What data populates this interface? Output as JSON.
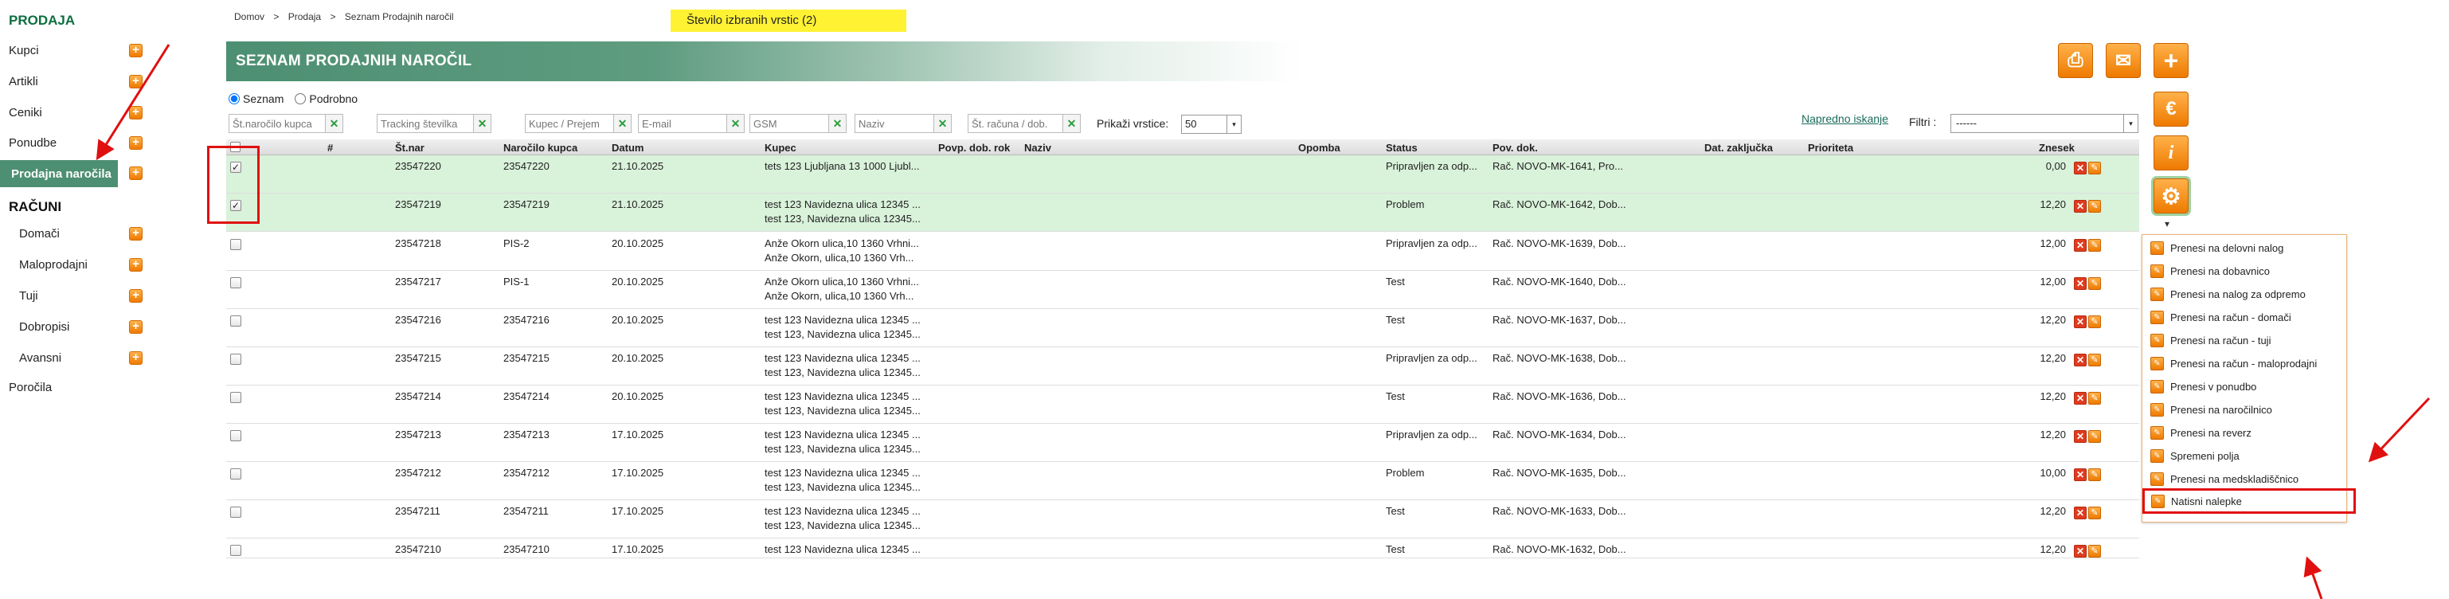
{
  "sidebar": {
    "prodaja_title": "PRODAJA",
    "prodaja_items": [
      {
        "label": "Kupci"
      },
      {
        "label": "Artikli"
      },
      {
        "label": "Ceniki"
      },
      {
        "label": "Ponudbe"
      },
      {
        "label": "Prodajna naročila"
      }
    ],
    "racuni_title": "RAČUNI",
    "racuni_items": [
      {
        "label": "Domači"
      },
      {
        "label": "Maloprodajni"
      },
      {
        "label": "Tuji"
      },
      {
        "label": "Dobropisi"
      },
      {
        "label": "Avansni"
      }
    ],
    "porocila": "Poročila",
    "plus_glyph": "+"
  },
  "breadcrumb": [
    "Domov",
    ">",
    "Prodaja",
    ">",
    "Seznam Prodajnih naročil"
  ],
  "selected_info": "Število izbranih vrstic (2)",
  "header": {
    "title": "SEZNAM PRODAJNIH NAROČIL"
  },
  "view_mode": {
    "seznam": "Seznam",
    "podrobno": "Podrobno"
  },
  "filters": {
    "placeholders": [
      "Št.naročilo kupca",
      "Tracking številka",
      "Kupec / Prejem",
      "E-mail",
      "GSM",
      "Naziv",
      "Št. računa / dob."
    ],
    "clear_glyph": "✕",
    "rows_label": "Prikaži vrstice:",
    "rows_value": "50",
    "advanced": "Napredno iskanje",
    "filter_label": "Filtri :",
    "filter_value": "------"
  },
  "table": {
    "headers": [
      "#",
      "Št.nar",
      "Naročilo kupca",
      "Datum",
      "Kupec",
      "Povp. dob. rok",
      "Naziv",
      "Opomba",
      "Status",
      "Pov. dok.",
      "Dat. zaključka",
      "Prioriteta",
      "Znesek"
    ],
    "rows": [
      {
        "stnar": "23547220",
        "narocilo": "23547220",
        "datum": "21.10.2025",
        "kupec1": "tets 123 Ljubljana 13 1000 Ljubl...",
        "kupec2": "",
        "status": "Pripravljen za odp...",
        "povdok": "Rač. NOVO-MK-1641, Pro...",
        "znesek": "0,00",
        "checked": "✓"
      },
      {
        "stnar": "23547219",
        "narocilo": "23547219",
        "datum": "21.10.2025",
        "kupec1": "test 123 Navidezna ulica 12345 ...",
        "kupec2": "test 123, Navidezna ulica 12345...",
        "status": "Problem",
        "povdok": "Rač. NOVO-MK-1642, Dob...",
        "znesek": "12,20",
        "checked": "✓"
      },
      {
        "stnar": "23547218",
        "narocilo": "PIS-2",
        "datum": "20.10.2025",
        "kupec1": "Anže Okorn ulica,10 1360 Vrhni...",
        "kupec2": "Anže Okorn, ulica,10 1360 Vrh...",
        "status": "Pripravljen za odp...",
        "povdok": "Rač. NOVO-MK-1639, Dob...",
        "znesek": "12,00",
        "checked": ""
      },
      {
        "stnar": "23547217",
        "narocilo": "PIS-1",
        "datum": "20.10.2025",
        "kupec1": "Anže Okorn ulica,10 1360 Vrhni...",
        "kupec2": "Anže Okorn, ulica,10 1360 Vrh...",
        "status": "Test",
        "povdok": "Rač. NOVO-MK-1640, Dob...",
        "znesek": "12,00",
        "checked": ""
      },
      {
        "stnar": "23547216",
        "narocilo": "23547216",
        "datum": "20.10.2025",
        "kupec1": "test 123 Navidezna ulica 12345 ...",
        "kupec2": "test 123, Navidezna ulica 12345...",
        "status": "Test",
        "povdok": "Rač. NOVO-MK-1637, Dob...",
        "znesek": "12,20",
        "checked": ""
      },
      {
        "stnar": "23547215",
        "narocilo": "23547215",
        "datum": "20.10.2025",
        "kupec1": "test 123 Navidezna ulica 12345 ...",
        "kupec2": "test 123, Navidezna ulica 12345...",
        "status": "Pripravljen za odp...",
        "povdok": "Rač. NOVO-MK-1638, Dob...",
        "znesek": "12,20",
        "checked": ""
      },
      {
        "stnar": "23547214",
        "narocilo": "23547214",
        "datum": "20.10.2025",
        "kupec1": "test 123 Navidezna ulica 12345 ...",
        "kupec2": "test 123, Navidezna ulica 12345...",
        "status": "Test",
        "povdok": "Rač. NOVO-MK-1636, Dob...",
        "znesek": "12,20",
        "checked": ""
      },
      {
        "stnar": "23547213",
        "narocilo": "23547213",
        "datum": "17.10.2025",
        "kupec1": "test 123 Navidezna ulica 12345 ...",
        "kupec2": "test 123, Navidezna ulica 12345...",
        "status": "Pripravljen za odp...",
        "povdok": "Rač. NOVO-MK-1634, Dob...",
        "znesek": "12,20",
        "checked": ""
      },
      {
        "stnar": "23547212",
        "narocilo": "23547212",
        "datum": "17.10.2025",
        "kupec1": "test 123 Navidezna ulica 12345 ...",
        "kupec2": "test 123, Navidezna ulica 12345...",
        "status": "Problem",
        "povdok": "Rač. NOVO-MK-1635, Dob...",
        "znesek": "10,00",
        "checked": ""
      },
      {
        "stnar": "23547211",
        "narocilo": "23547211",
        "datum": "17.10.2025",
        "kupec1": "test 123 Navidezna ulica 12345 ...",
        "kupec2": "test 123, Navidezna ulica 12345...",
        "status": "Test",
        "povdok": "Rač. NOVO-MK-1633, Dob...",
        "znesek": "12,20",
        "checked": ""
      },
      {
        "stnar": "23547210",
        "narocilo": "23547210",
        "datum": "17.10.2025",
        "kupec1": "test 123 Navidezna ulica 12345 ...",
        "kupec2": "",
        "status": "Test",
        "povdok": "Rač. NOVO-MK-1632, Dob...",
        "znesek": "12,20",
        "checked": ""
      }
    ],
    "delete_glyph": "✕",
    "edit_glyph": "✎"
  },
  "toolbar": {
    "print_glyph": "⎙",
    "mail_glyph": "✉",
    "add_glyph": "+",
    "euro_glyph": "€",
    "info_glyph": "i",
    "settings_glyph": "⚙",
    "caret_glyph": "▾"
  },
  "menu": {
    "items": [
      "Prenesi na delovni nalog",
      "Prenesi na dobavnico",
      "Prenesi na nalog za odpremo",
      "Prenesi na račun - domači",
      "Prenesi na račun - tuji",
      "Prenesi na račun - maloprodajni",
      "Prenesi v ponudbo",
      "Prenesi na naročilnico",
      "Prenesi na reverz",
      "Spremeni polja",
      "Prenesi na medskladiščnico",
      "Natisni nalepke"
    ],
    "item_glyph": "✎"
  },
  "colors": {
    "brand_green": "#4d8f72",
    "accent_orange": "#ee7a00",
    "selected_row": "#d9f2da",
    "annotation_red": "#e01010",
    "info_yellow": "#fff233"
  }
}
